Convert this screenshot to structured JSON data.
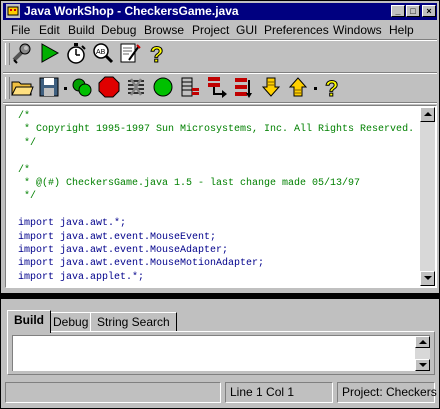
{
  "window": {
    "title": "Java WorkShop - CheckersGame.java",
    "controls": {
      "minimize": "_",
      "maximize": "□",
      "close": "×"
    }
  },
  "menubar": {
    "items": [
      "File",
      "Edit",
      "Build",
      "Debug",
      "Browse",
      "Project",
      "GUI",
      "Preferences",
      "Windows",
      "Help"
    ]
  },
  "toolbar1": {
    "buttons": [
      "wrench-icon",
      "run-icon",
      "stopwatch-icon",
      "find-icon",
      "edit-icon",
      "help-icon"
    ]
  },
  "toolbar2": {
    "buttons": [
      "open-folder-icon",
      "save-disk-icon",
      "breakpoint-icon",
      "stop-icon",
      "clear-icon",
      "go-icon",
      "stack-icon",
      "step-into-icon",
      "step-over-icon",
      "step-out-icon",
      "step-up-icon",
      "help-icon"
    ]
  },
  "editor": {
    "lines": [
      {
        "type": "comment",
        "text": "/*"
      },
      {
        "type": "comment",
        "text": " * Copyright 1995-1997 Sun Microsystems, Inc. All Rights Reserved."
      },
      {
        "type": "comment",
        "text": " */"
      },
      {
        "type": "blank",
        "text": ""
      },
      {
        "type": "comment",
        "text": "/*"
      },
      {
        "type": "comment",
        "text": " * @(#) CheckersGame.java 1.5 - last change made 05/13/97"
      },
      {
        "type": "comment",
        "text": " */"
      },
      {
        "type": "blank",
        "text": ""
      },
      {
        "type": "import",
        "keyword": "import",
        "text": " java.awt.*;"
      },
      {
        "type": "import",
        "keyword": "import",
        "text": " java.awt.event.MouseEvent;"
      },
      {
        "type": "import",
        "keyword": "import",
        "text": " java.awt.event.MouseAdapter;"
      },
      {
        "type": "import",
        "keyword": "import",
        "text": " java.awt.event.MouseMotionAdapter;"
      },
      {
        "type": "import",
        "keyword": "import",
        "text": " java.applet.*;"
      }
    ]
  },
  "output": {
    "tabs": [
      "Build",
      "Debug",
      "String Search"
    ],
    "active_tab": "Build"
  },
  "statusbar": {
    "message": "",
    "position": "Line 1 Col 1",
    "project": "Project: Checkers"
  },
  "colors": {
    "title_bar": "#000080",
    "comment": "#008000",
    "keyword": "#00008b",
    "face": "#c0c0c0"
  }
}
